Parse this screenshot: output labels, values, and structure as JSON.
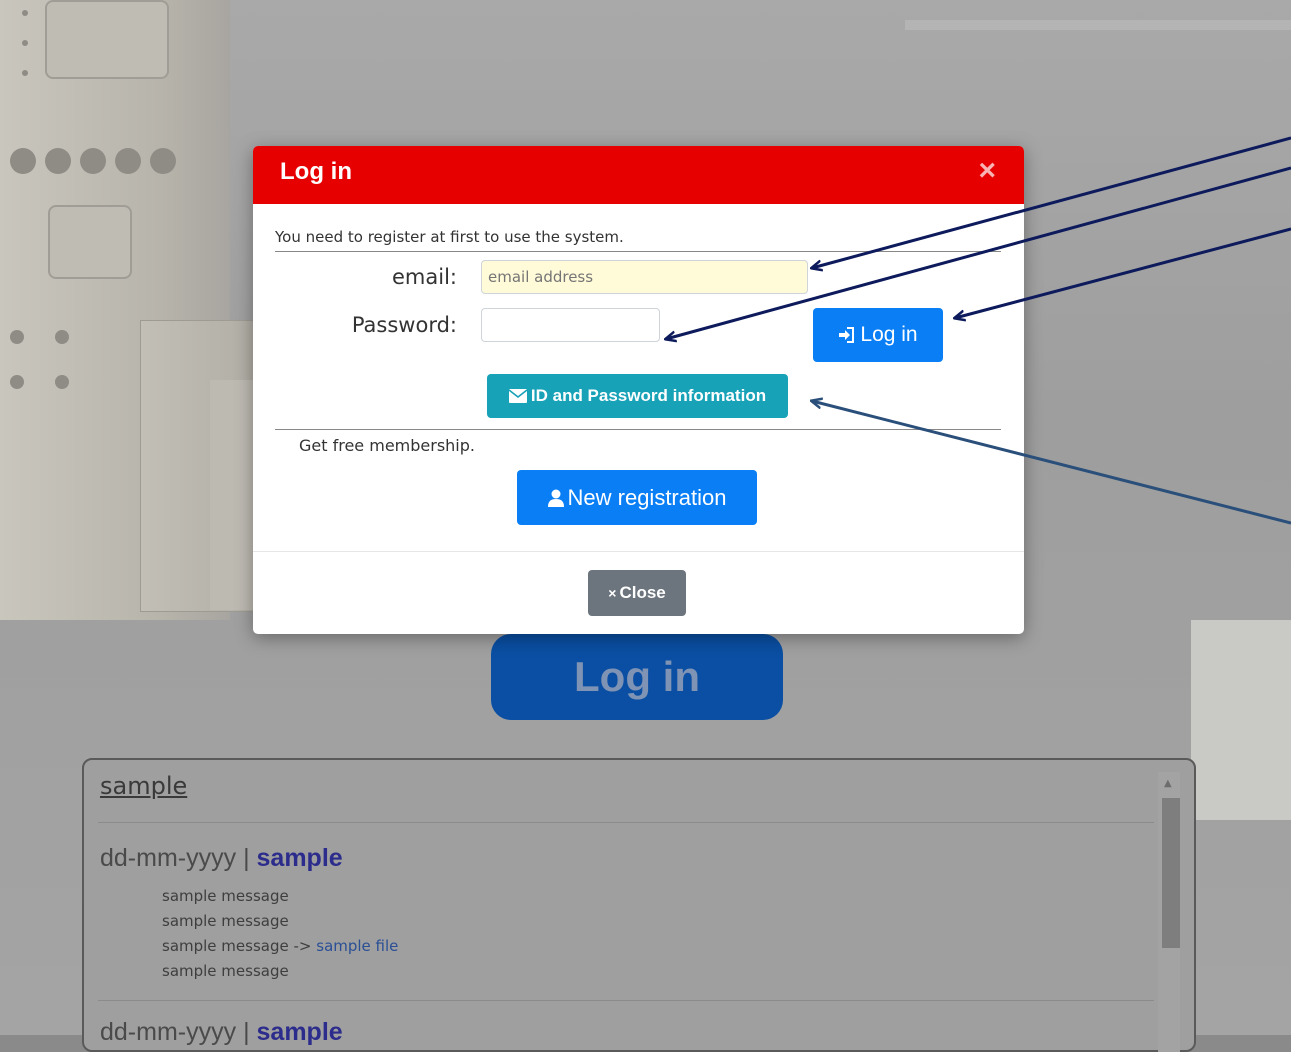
{
  "modal": {
    "title": "Log in",
    "close_x": "×",
    "intro": "You need to register at first to use the system.",
    "email_label": "email:",
    "email_placeholder": "email address",
    "password_label": "Password:",
    "login_button": "Log in",
    "id_password_button": "ID and Password information",
    "membership_text": "Get free membership.",
    "new_registration_button": "New registration",
    "close_button": "Close",
    "close_button_icon": "×"
  },
  "background": {
    "login_button": "Log in",
    "news": {
      "title": "sample",
      "items": [
        {
          "date": "dd-mm-yyyy",
          "separator": "|",
          "link": "sample",
          "messages": [
            "sample message",
            "sample message",
            "sample message ->",
            "sample message"
          ],
          "file_link": "sample file"
        },
        {
          "date": "dd-mm-yyyy",
          "separator": "|",
          "link": "sample"
        }
      ]
    }
  },
  "colors": {
    "header_red": "#e60000",
    "primary_blue": "#0a7ff5",
    "info_teal": "#17a2b8",
    "secondary_gray": "#6c757d",
    "arrow_navy": "#0d1a5c"
  }
}
